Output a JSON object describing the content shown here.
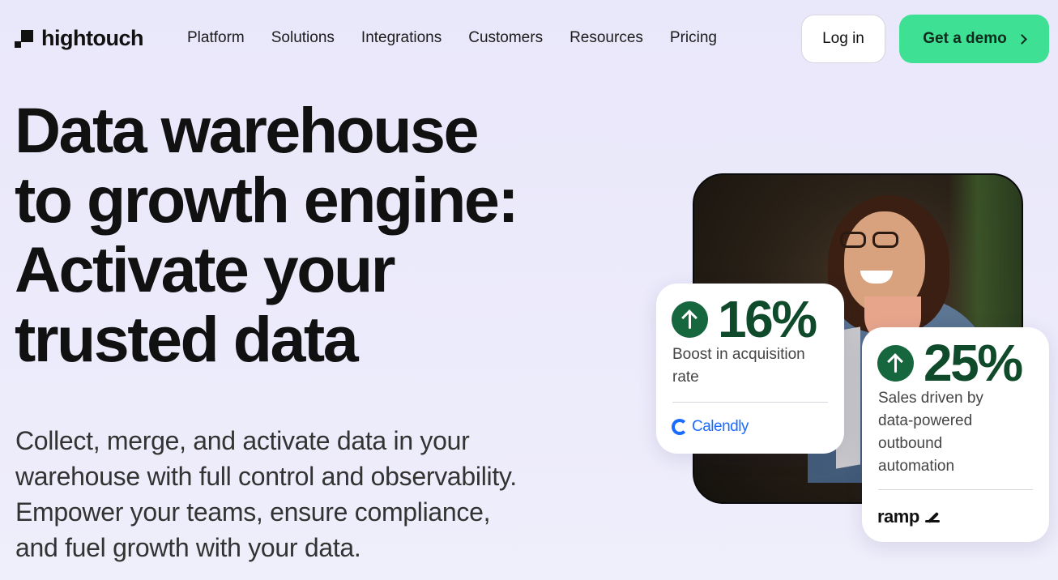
{
  "header": {
    "logo_text": "hightouch",
    "nav": [
      "Platform",
      "Solutions",
      "Integrations",
      "Customers",
      "Resources",
      "Pricing"
    ],
    "login_label": "Log in",
    "demo_label": "Get a demo"
  },
  "hero": {
    "title_lines": [
      "Data warehouse",
      "to growth engine:",
      "Activate your",
      "trusted data"
    ],
    "subtitle_lines": [
      "Collect, merge, and activate data in your",
      "warehouse with full control and observability.",
      "Empower your teams, ensure compliance,",
      "and fuel growth with your data."
    ]
  },
  "stats": [
    {
      "value": "16%",
      "label_lines": [
        "Boost in acquisition",
        "rate"
      ],
      "brand": "Calendly",
      "icon": "arrow-up-icon",
      "brand_color": "#1a6bff"
    },
    {
      "value": "25%",
      "label_lines": [
        "Sales driven by",
        "data-powered",
        "outbound",
        "automation"
      ],
      "brand": "ramp",
      "icon": "arrow-up-icon"
    }
  ],
  "colors": {
    "accent_green": "#3ee094",
    "stat_green": "#0f4b2b",
    "background": "#eceafa"
  }
}
